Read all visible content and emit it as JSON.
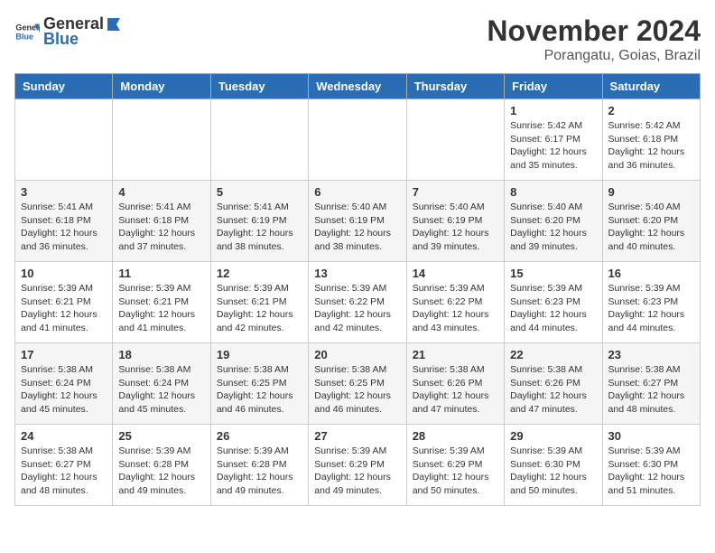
{
  "header": {
    "logo_general": "General",
    "logo_blue": "Blue",
    "month_title": "November 2024",
    "location": "Porangatu, Goias, Brazil"
  },
  "weekdays": [
    "Sunday",
    "Monday",
    "Tuesday",
    "Wednesday",
    "Thursday",
    "Friday",
    "Saturday"
  ],
  "weeks": [
    [
      {
        "day": "",
        "info": ""
      },
      {
        "day": "",
        "info": ""
      },
      {
        "day": "",
        "info": ""
      },
      {
        "day": "",
        "info": ""
      },
      {
        "day": "",
        "info": ""
      },
      {
        "day": "1",
        "info": "Sunrise: 5:42 AM\nSunset: 6:17 PM\nDaylight: 12 hours\nand 35 minutes."
      },
      {
        "day": "2",
        "info": "Sunrise: 5:42 AM\nSunset: 6:18 PM\nDaylight: 12 hours\nand 36 minutes."
      }
    ],
    [
      {
        "day": "3",
        "info": "Sunrise: 5:41 AM\nSunset: 6:18 PM\nDaylight: 12 hours\nand 36 minutes."
      },
      {
        "day": "4",
        "info": "Sunrise: 5:41 AM\nSunset: 6:18 PM\nDaylight: 12 hours\nand 37 minutes."
      },
      {
        "day": "5",
        "info": "Sunrise: 5:41 AM\nSunset: 6:19 PM\nDaylight: 12 hours\nand 38 minutes."
      },
      {
        "day": "6",
        "info": "Sunrise: 5:40 AM\nSunset: 6:19 PM\nDaylight: 12 hours\nand 38 minutes."
      },
      {
        "day": "7",
        "info": "Sunrise: 5:40 AM\nSunset: 6:19 PM\nDaylight: 12 hours\nand 39 minutes."
      },
      {
        "day": "8",
        "info": "Sunrise: 5:40 AM\nSunset: 6:20 PM\nDaylight: 12 hours\nand 39 minutes."
      },
      {
        "day": "9",
        "info": "Sunrise: 5:40 AM\nSunset: 6:20 PM\nDaylight: 12 hours\nand 40 minutes."
      }
    ],
    [
      {
        "day": "10",
        "info": "Sunrise: 5:39 AM\nSunset: 6:21 PM\nDaylight: 12 hours\nand 41 minutes."
      },
      {
        "day": "11",
        "info": "Sunrise: 5:39 AM\nSunset: 6:21 PM\nDaylight: 12 hours\nand 41 minutes."
      },
      {
        "day": "12",
        "info": "Sunrise: 5:39 AM\nSunset: 6:21 PM\nDaylight: 12 hours\nand 42 minutes."
      },
      {
        "day": "13",
        "info": "Sunrise: 5:39 AM\nSunset: 6:22 PM\nDaylight: 12 hours\nand 42 minutes."
      },
      {
        "day": "14",
        "info": "Sunrise: 5:39 AM\nSunset: 6:22 PM\nDaylight: 12 hours\nand 43 minutes."
      },
      {
        "day": "15",
        "info": "Sunrise: 5:39 AM\nSunset: 6:23 PM\nDaylight: 12 hours\nand 44 minutes."
      },
      {
        "day": "16",
        "info": "Sunrise: 5:39 AM\nSunset: 6:23 PM\nDaylight: 12 hours\nand 44 minutes."
      }
    ],
    [
      {
        "day": "17",
        "info": "Sunrise: 5:38 AM\nSunset: 6:24 PM\nDaylight: 12 hours\nand 45 minutes."
      },
      {
        "day": "18",
        "info": "Sunrise: 5:38 AM\nSunset: 6:24 PM\nDaylight: 12 hours\nand 45 minutes."
      },
      {
        "day": "19",
        "info": "Sunrise: 5:38 AM\nSunset: 6:25 PM\nDaylight: 12 hours\nand 46 minutes."
      },
      {
        "day": "20",
        "info": "Sunrise: 5:38 AM\nSunset: 6:25 PM\nDaylight: 12 hours\nand 46 minutes."
      },
      {
        "day": "21",
        "info": "Sunrise: 5:38 AM\nSunset: 6:26 PM\nDaylight: 12 hours\nand 47 minutes."
      },
      {
        "day": "22",
        "info": "Sunrise: 5:38 AM\nSunset: 6:26 PM\nDaylight: 12 hours\nand 47 minutes."
      },
      {
        "day": "23",
        "info": "Sunrise: 5:38 AM\nSunset: 6:27 PM\nDaylight: 12 hours\nand 48 minutes."
      }
    ],
    [
      {
        "day": "24",
        "info": "Sunrise: 5:38 AM\nSunset: 6:27 PM\nDaylight: 12 hours\nand 48 minutes."
      },
      {
        "day": "25",
        "info": "Sunrise: 5:39 AM\nSunset: 6:28 PM\nDaylight: 12 hours\nand 49 minutes."
      },
      {
        "day": "26",
        "info": "Sunrise: 5:39 AM\nSunset: 6:28 PM\nDaylight: 12 hours\nand 49 minutes."
      },
      {
        "day": "27",
        "info": "Sunrise: 5:39 AM\nSunset: 6:29 PM\nDaylight: 12 hours\nand 49 minutes."
      },
      {
        "day": "28",
        "info": "Sunrise: 5:39 AM\nSunset: 6:29 PM\nDaylight: 12 hours\nand 50 minutes."
      },
      {
        "day": "29",
        "info": "Sunrise: 5:39 AM\nSunset: 6:30 PM\nDaylight: 12 hours\nand 50 minutes."
      },
      {
        "day": "30",
        "info": "Sunrise: 5:39 AM\nSunset: 6:30 PM\nDaylight: 12 hours\nand 51 minutes."
      }
    ]
  ]
}
